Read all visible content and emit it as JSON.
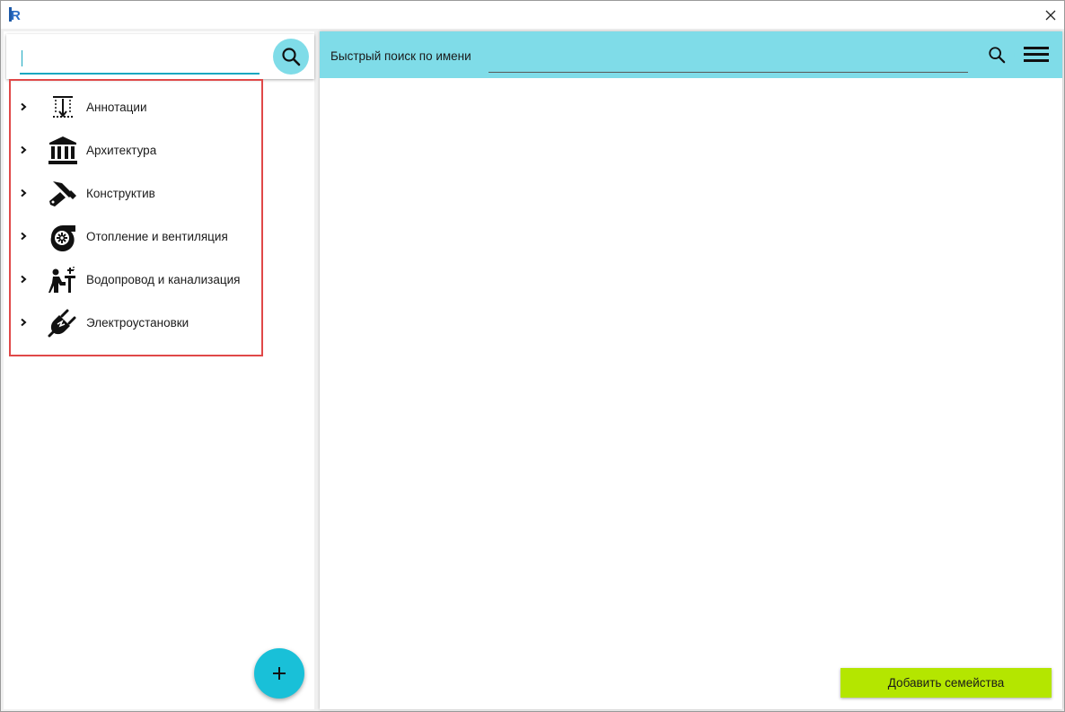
{
  "window": {
    "app_icon_letter": "R",
    "close_glyph": "✕"
  },
  "left": {
    "search": {
      "value": "",
      "placeholder": ""
    },
    "categories": [
      {
        "label": "Аннотации",
        "icon": "annotation-icon"
      },
      {
        "label": "Архитектура",
        "icon": "building-icon"
      },
      {
        "label": "Конструктив",
        "icon": "structure-tool-icon"
      },
      {
        "label": "Отопление и вентиляция",
        "icon": "fan-icon"
      },
      {
        "label": "Водопровод и канализация",
        "icon": "plumbing-icon"
      },
      {
        "label": "Электроустановки",
        "icon": "electric-plug-icon"
      }
    ],
    "fab_glyph": "+"
  },
  "right": {
    "quick_search_label": "Быстрый поиск по имени",
    "quick_search_value": "",
    "add_families_label": "Добавить семейства"
  },
  "colors": {
    "accent_cyan": "#7fdce8",
    "fab_cyan": "#19c0d8",
    "input_underline": "#1aa7c0",
    "highlight_red": "#e04848",
    "button_green": "#b4e600"
  }
}
